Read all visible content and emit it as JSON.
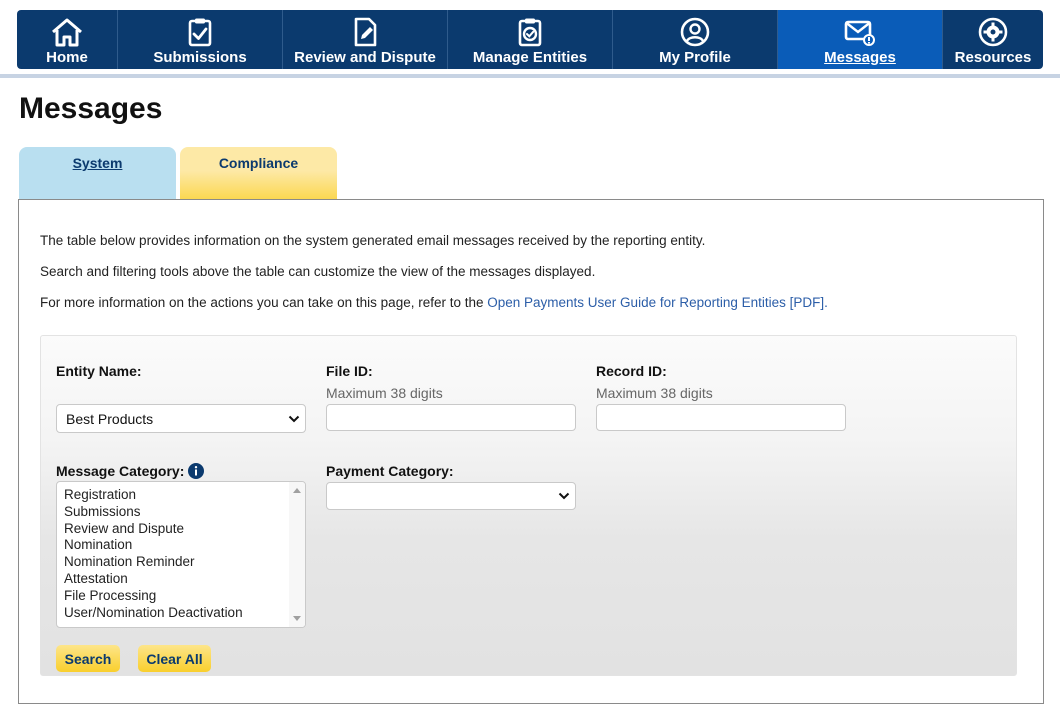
{
  "nav": {
    "items": [
      {
        "label": "Home",
        "icon": "home-icon",
        "active": false
      },
      {
        "label": "Submissions",
        "icon": "clipboard-check-icon",
        "active": false
      },
      {
        "label": "Review and Dispute",
        "icon": "document-edit-icon",
        "active": false
      },
      {
        "label": "Manage Entities",
        "icon": "clipboard-badge-icon",
        "active": false
      },
      {
        "label": "My Profile",
        "icon": "user-circle-icon",
        "active": false
      },
      {
        "label": "Messages",
        "icon": "mail-alert-icon",
        "active": true
      },
      {
        "label": "Resources",
        "icon": "gear-icon",
        "active": false
      }
    ]
  },
  "page": {
    "title": "Messages"
  },
  "tabs": [
    {
      "label": "System",
      "active": true
    },
    {
      "label": "Compliance",
      "active": false
    }
  ],
  "intro": {
    "line1": "The table below provides information on the system generated email messages received by the reporting entity.",
    "line2": "Search and filtering tools above the table can customize the view of the messages displayed.",
    "line3_prefix": "For more information on the actions you can take on this page, refer to the ",
    "line3_link": "Open Payments User Guide for Reporting Entities [PDF]."
  },
  "filters": {
    "entity_name": {
      "label": "Entity Name:",
      "value": "Best Products"
    },
    "file_id": {
      "label": "File ID:",
      "hint": "Maximum 38 digits",
      "value": ""
    },
    "record_id": {
      "label": "Record ID:",
      "hint": "Maximum 38 digits",
      "value": ""
    },
    "message_category": {
      "label": "Message Category:",
      "options": [
        "Registration",
        "Submissions",
        "Review and Dispute",
        "Nomination",
        "Nomination Reminder",
        "Attestation",
        "File Processing",
        "User/Nomination Deactivation"
      ]
    },
    "payment_category": {
      "label": "Payment Category:",
      "value": ""
    }
  },
  "buttons": {
    "search": "Search",
    "clear_all": "Clear All"
  },
  "colors": {
    "nav_bg": "#0b3a6e",
    "nav_active": "#0a5cb8",
    "tab_system": "#b9dff0",
    "tab_compliance": "#fbd74e",
    "link": "#2c5ea8",
    "button": "#f9cf2c"
  }
}
